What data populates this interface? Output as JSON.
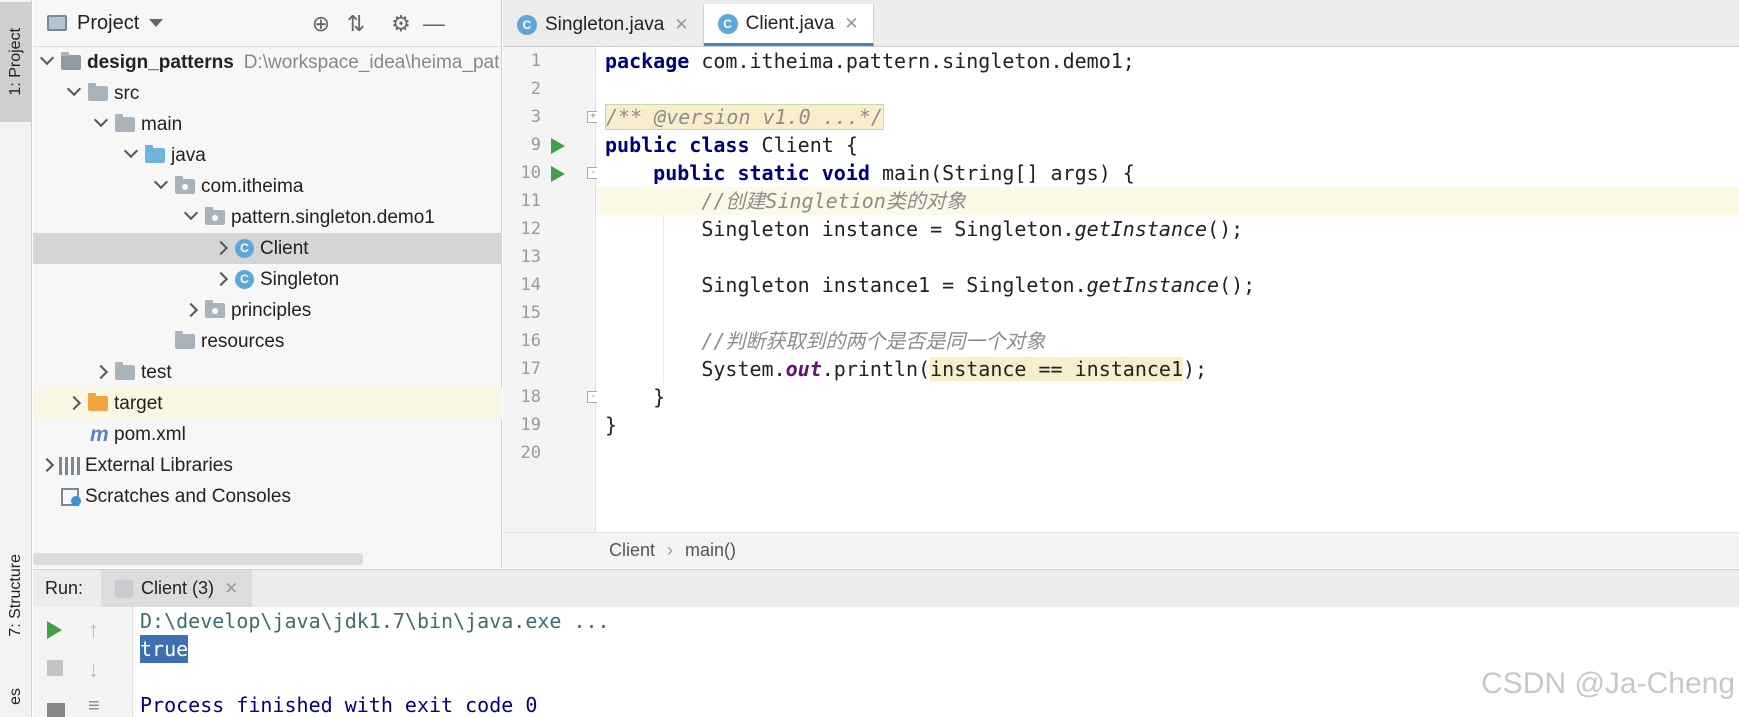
{
  "tool_windows": {
    "project_tab": "1: Project",
    "structure_tab": "7: Structure",
    "favorites_tab": "es"
  },
  "project": {
    "title": "Project",
    "tree": [
      {
        "label": "design_patterns",
        "extra": "D:\\workspace_idea\\heima_pat",
        "bold": true
      },
      {
        "label": "src"
      },
      {
        "label": "main"
      },
      {
        "label": "java"
      },
      {
        "label": "com.itheima"
      },
      {
        "label": "pattern.singleton.demo1"
      },
      {
        "label": "Client"
      },
      {
        "label": "Singleton"
      },
      {
        "label": "principles"
      },
      {
        "label": "resources"
      },
      {
        "label": "test"
      },
      {
        "label": "target"
      },
      {
        "label": "pom.xml"
      },
      {
        "label": "External Libraries"
      },
      {
        "label": "Scratches and Consoles"
      }
    ]
  },
  "editor": {
    "tabs": [
      {
        "label": "Singleton.java",
        "icon": "C"
      },
      {
        "label": "Client.java",
        "icon": "C"
      }
    ],
    "line_numbers": [
      "1",
      "2",
      "3",
      "9",
      "10",
      "11",
      "12",
      "13",
      "14",
      "15",
      "16",
      "17",
      "18",
      "19",
      "20"
    ],
    "code": {
      "l1_kw": "package",
      "l1_rest": " com.itheima.pattern.singleton.demo1;",
      "l3_folded": "/** @version v1.0 ...*/",
      "l9_kw": "public class",
      "l9_rest": " Client {",
      "l10_indent": "    ",
      "l10_kw": "public static void",
      "l10_rest": " main(String[] args) {",
      "l11": "        //创建Singletion类的对象",
      "l12_a": "        Singleton instance = Singleton.",
      "l12_m": "getInstance",
      "l12_b": "();",
      "l14_a": "        Singleton instance1 = Singleton.",
      "l14_m": "getInstance",
      "l14_b": "();",
      "l16": "        //判断获取到的两个是否是同一个对象",
      "l17_a": "        System.",
      "l17_out": "out",
      "l17_b": ".println(",
      "l17_arg": "instance == instance1",
      "l17_c": ");",
      "l18": "    }",
      "l19": "}"
    },
    "breadcrumb": [
      "Client",
      "main()"
    ]
  },
  "run": {
    "label": "Run:",
    "tab": "Client (3)",
    "console": {
      "cmd": "D:\\develop\\java\\jdk1.7\\bin\\java.exe ...",
      "output": "true",
      "exit": "Process finished with exit code 0"
    }
  },
  "watermark": "CSDN @Ja-Cheng"
}
